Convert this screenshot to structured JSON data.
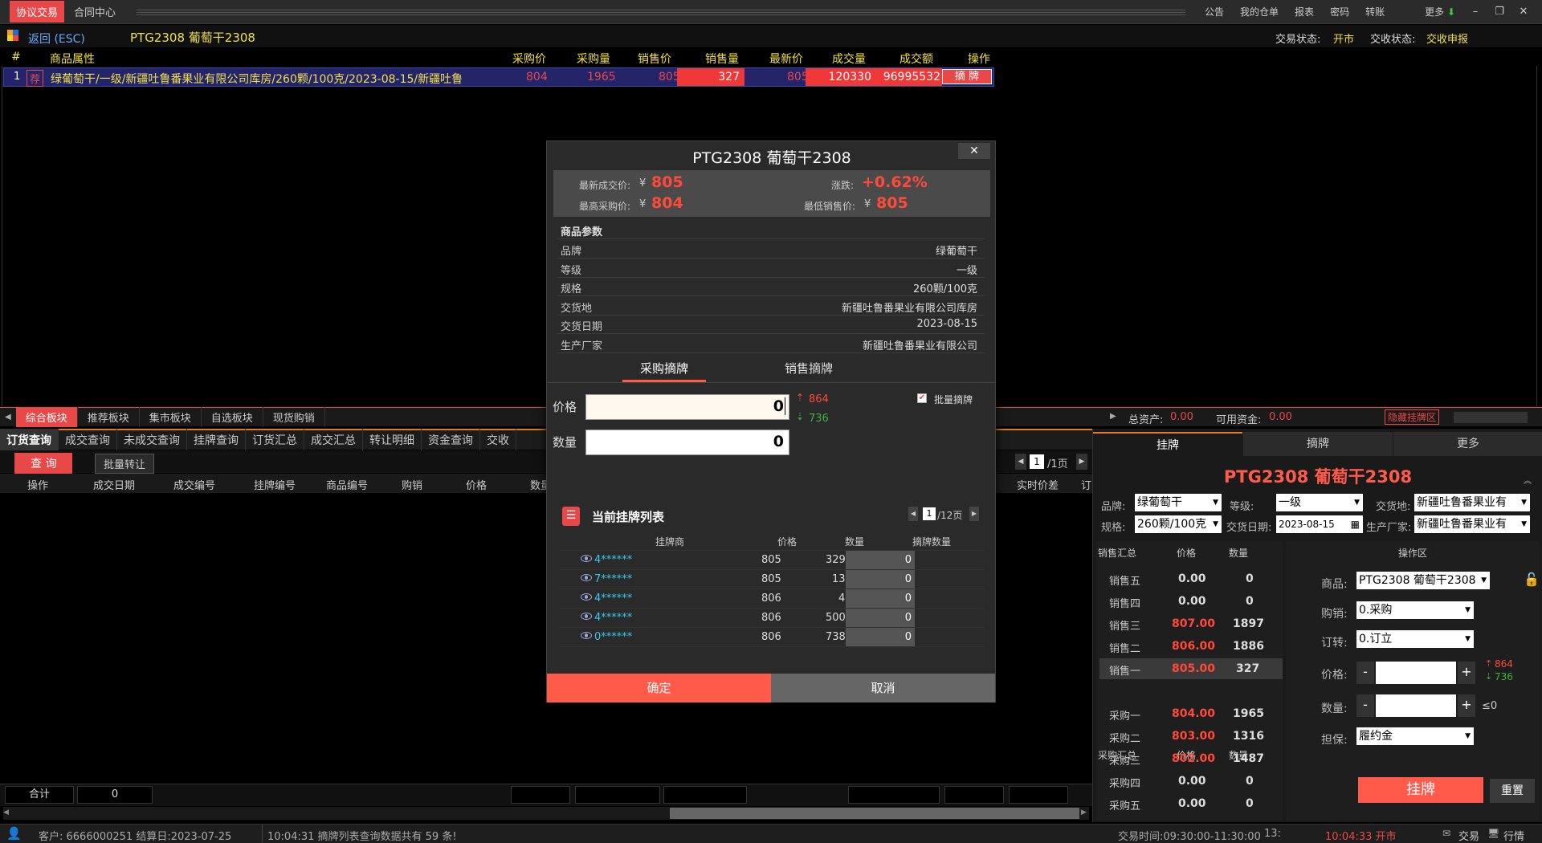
{
  "titlebar": {
    "active_tab": "协议交易",
    "tab2": "合同中心",
    "menu": [
      "公告",
      "我的仓单",
      "报表",
      "密码",
      "转账"
    ],
    "more": "更多",
    "win_min": "–",
    "win_restore": "❐",
    "win_close": "✕"
  },
  "infobar": {
    "back": "返回 (ESC)",
    "product": "PTG2308 葡萄干2308",
    "trade_status_label": "交易状态:",
    "trade_status": "开市",
    "delivery_status_label": "交收状态:",
    "delivery_status": "交收申报"
  },
  "main_table": {
    "headers": [
      "#",
      "商品属性",
      "采购价",
      "采购量",
      "销售价",
      "销售量",
      "最新价",
      "成交量",
      "成交额",
      "操作"
    ],
    "row": {
      "index": "1",
      "tag": "荐",
      "desc": "绿葡萄干/一级/新疆吐鲁番果业有限公司库房/260颗/100克/2023-08-15/新疆吐鲁",
      "buy_price": "804",
      "buy_qty": "1965",
      "sell_price": "805",
      "sell_qty": "327",
      "last_price": "805",
      "volume": "120330",
      "amount": "96995532",
      "action": "摘 牌"
    }
  },
  "midbar": {
    "tabs": [
      "综合板块",
      "推荐板块",
      "集市板块",
      "自选板块",
      "现货购销"
    ],
    "total_assets_label": "总资产:",
    "total_assets": "0.00",
    "available_label": "可用资金:",
    "available": "0.00",
    "hide_btn": "隐藏挂牌区"
  },
  "lower": {
    "tabs": [
      "订货查询",
      "成交查询",
      "未成交查询",
      "挂牌查询",
      "订货汇总",
      "成交汇总",
      "转让明细",
      "资金查询",
      "交收"
    ],
    "query_btn": "查 询",
    "batch_btn": "批量转让",
    "page_current": "1",
    "page_total": "/1页",
    "headers": [
      "操作",
      "成交日期",
      "成交编号",
      "挂牌编号",
      "商品编号",
      "购销",
      "价格",
      "数量",
      "实时价差",
      "订"
    ],
    "sum_label": "合计",
    "sum_value": "0"
  },
  "right_panel": {
    "tabs": [
      "挂牌",
      "摘牌",
      "更多"
    ],
    "title": "PTG2308 葡萄干2308",
    "brand_label": "品牌:",
    "brand": "绿葡萄干",
    "grade_label": "等级:",
    "grade": "一级",
    "delivery_place_label": "交货地:",
    "delivery_place": "新疆吐鲁番果业有",
    "spec_label": "规格:",
    "spec": "260颗/100克",
    "delivery_date_label": "交货日期:",
    "delivery_date": "2023-08-15",
    "maker_label": "生产厂家:",
    "maker": "新疆吐鲁番果业有",
    "sell_summary": "销售汇总",
    "buy_summary": "采购汇总",
    "col_price": "价格",
    "col_qty": "数量",
    "sells": [
      {
        "name": "销售五",
        "price": "0.00",
        "qty": "0"
      },
      {
        "name": "销售四",
        "price": "0.00",
        "qty": "0"
      },
      {
        "name": "销售三",
        "price": "807.00",
        "qty": "1897"
      },
      {
        "name": "销售二",
        "price": "806.00",
        "qty": "1886"
      },
      {
        "name": "销售一",
        "price": "805.00",
        "qty": "327"
      }
    ],
    "buys": [
      {
        "name": "采购一",
        "price": "804.00",
        "qty": "1965"
      },
      {
        "name": "采购二",
        "price": "803.00",
        "qty": "1316"
      },
      {
        "name": "采购三",
        "price": "802.00",
        "qty": "1487"
      },
      {
        "name": "采购四",
        "price": "0.00",
        "qty": "0"
      },
      {
        "name": "采购五",
        "price": "0.00",
        "qty": "0"
      }
    ],
    "op_title": "操作区",
    "product_label": "商品:",
    "product": "PTG2308 葡萄干2308",
    "side_label": "购销:",
    "side": "0.采购",
    "order_label": "订转:",
    "order": "0.订立",
    "price_label": "价格:",
    "qty_label": "数量:",
    "qty_limit": "≤0",
    "up_limit": "864",
    "down_limit": "736",
    "guarantee_label": "担保:",
    "guarantee": "履约金",
    "submit": "挂牌",
    "reset": "重置"
  },
  "statusbar": {
    "client": "客户: 6666000251 结算日:2023-07-25",
    "message": "10:04:31 摘牌列表查询数据共有 59 条!",
    "trade_time": "交易时间:09:30:00-11:30:00",
    "time_extra": "13:",
    "clock": "10:04:33 开市",
    "trade": "交易",
    "quote": "行情"
  },
  "dialog": {
    "title": "PTG2308 葡萄干2308",
    "close": "✕",
    "last_price_label": "最新成交价:",
    "last_price": "805",
    "change_label": "涨跌:",
    "change": "+0.62%",
    "max_buy_label": "最高采购价:",
    "max_buy": "804",
    "min_sell_label": "最低销售价:",
    "min_sell": "805",
    "currency": "¥",
    "params_title": "商品参数",
    "params": [
      {
        "label": "品牌",
        "value": "绿葡萄干"
      },
      {
        "label": "等级",
        "value": "一级"
      },
      {
        "label": "规格",
        "value": "260颗/100克"
      },
      {
        "label": "交货地",
        "value": "新疆吐鲁番果业有限公司库房"
      },
      {
        "label": "交货日期",
        "value": "2023-08-15"
      },
      {
        "label": "生产厂家",
        "value": "新疆吐鲁番果业有限公司"
      }
    ],
    "tab_buy": "采购摘牌",
    "tab_sell": "销售摘牌",
    "price_label": "价格",
    "price_value": "0",
    "qty_label": "数量",
    "qty_value": "0",
    "up_limit": "864",
    "down_limit": "736",
    "batch_label": "批量摘牌",
    "list_title": "当前挂牌列表",
    "page_current": "1",
    "page_total": "/12页",
    "list_headers": [
      "挂牌商",
      "价格",
      "数量",
      "摘牌数量"
    ],
    "list": [
      {
        "trader": "4******",
        "price": "805",
        "qty": "329",
        "pick": "0"
      },
      {
        "trader": "7******",
        "price": "805",
        "qty": "13",
        "pick": "0"
      },
      {
        "trader": "4******",
        "price": "806",
        "qty": "4",
        "pick": "0"
      },
      {
        "trader": "4******",
        "price": "806",
        "qty": "500",
        "pick": "0"
      },
      {
        "trader": "0******",
        "price": "806",
        "qty": "738",
        "pick": "0"
      }
    ],
    "confirm": "确定",
    "cancel": "取消"
  }
}
